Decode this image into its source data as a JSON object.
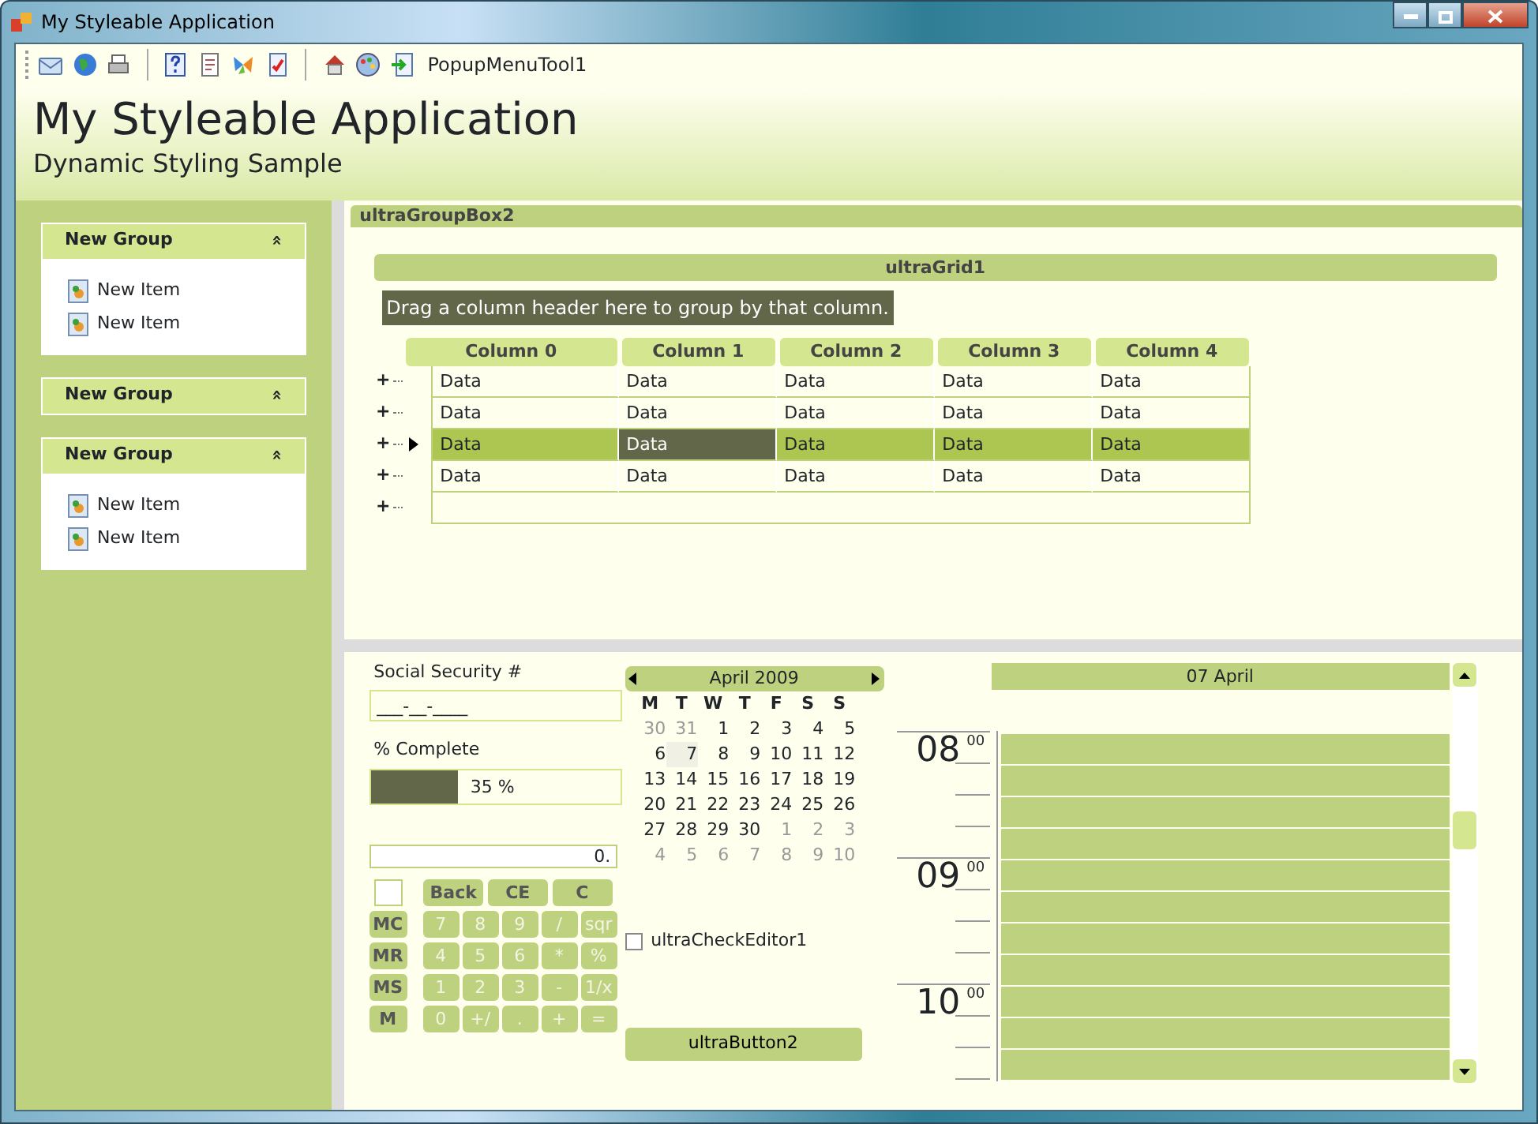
{
  "window": {
    "title": "My Styleable Application"
  },
  "toolbar": {
    "popup_label": "PopupMenuTool1"
  },
  "header": {
    "title": "My Styleable Application",
    "subtitle": "Dynamic Styling Sample"
  },
  "sidebar": {
    "groups": [
      {
        "title": "New Group",
        "chevron": "»",
        "items": [
          {
            "label": "New Item"
          },
          {
            "label": "New Item"
          }
        ]
      },
      {
        "title": "New Group",
        "chevron": "»"
      },
      {
        "title": "New Group",
        "chevron": "»",
        "items": [
          {
            "label": "New Item"
          },
          {
            "label": "New Item"
          }
        ]
      }
    ]
  },
  "group_box": {
    "title": "ultraGroupBox2"
  },
  "grid": {
    "caption": "ultraGrid1",
    "group_by_hint": "Drag a column header here to group by that column.",
    "columns": [
      "Column 0",
      "Column 1",
      "Column 2",
      "Column 3",
      "Column 4"
    ],
    "rows": [
      {
        "expander": "+",
        "selected": false,
        "cells": [
          {
            "text": "Data",
            "active": false
          },
          {
            "text": "Data",
            "active": false
          },
          {
            "text": "Data",
            "active": false
          },
          {
            "text": "Data",
            "active": false
          },
          {
            "text": "Data",
            "active": false
          }
        ]
      },
      {
        "expander": "+",
        "selected": false,
        "cells": [
          {
            "text": "Data",
            "active": false
          },
          {
            "text": "Data",
            "active": false
          },
          {
            "text": "Data",
            "active": false
          },
          {
            "text": "Data",
            "active": false
          },
          {
            "text": "Data",
            "active": false
          }
        ]
      },
      {
        "expander": "+",
        "selected": true,
        "cells": [
          {
            "text": "Data",
            "active": false
          },
          {
            "text": "Data",
            "active": true
          },
          {
            "text": "Data",
            "active": false
          },
          {
            "text": "Data",
            "active": false
          },
          {
            "text": "Data",
            "active": false
          }
        ]
      },
      {
        "expander": "+",
        "selected": false,
        "cells": [
          {
            "text": "Data",
            "active": false
          },
          {
            "text": "Data",
            "active": false
          },
          {
            "text": "Data",
            "active": false
          },
          {
            "text": "Data",
            "active": false
          },
          {
            "text": "Data",
            "active": false
          }
        ]
      }
    ],
    "add_row": {
      "expander": "+"
    }
  },
  "masked_editor": {
    "label": "Social Security #",
    "value": "___-__-____"
  },
  "progress": {
    "label": "% Complete",
    "level": 0.35,
    "reading": "35 %"
  },
  "calculator": {
    "display": "0.",
    "top_keys": [
      "Back",
      "CE",
      "C"
    ],
    "key_rows": [
      [
        {
          "label": "MC",
          "kind": "memory"
        },
        {
          "label": "7",
          "kind": "digit"
        },
        {
          "label": "8",
          "kind": "digit"
        },
        {
          "label": "9",
          "kind": "digit"
        },
        {
          "label": "/",
          "kind": "digit"
        },
        {
          "label": "sqr",
          "kind": "digit"
        }
      ],
      [
        {
          "label": "MR",
          "kind": "memory"
        },
        {
          "label": "4",
          "kind": "digit"
        },
        {
          "label": "5",
          "kind": "digit"
        },
        {
          "label": "6",
          "kind": "digit"
        },
        {
          "label": "*",
          "kind": "digit"
        },
        {
          "label": "%",
          "kind": "digit"
        }
      ],
      [
        {
          "label": "MS",
          "kind": "memory"
        },
        {
          "label": "1",
          "kind": "digit"
        },
        {
          "label": "2",
          "kind": "digit"
        },
        {
          "label": "3",
          "kind": "digit"
        },
        {
          "label": "-",
          "kind": "digit"
        },
        {
          "label": "1/x",
          "kind": "digit"
        }
      ],
      [
        {
          "label": "M",
          "kind": "memory"
        },
        {
          "label": "0",
          "kind": "digit"
        },
        {
          "label": "+/",
          "kind": "digit"
        },
        {
          "label": ".",
          "kind": "digit"
        },
        {
          "label": "+",
          "kind": "digit"
        },
        {
          "label": "=",
          "kind": "digit"
        }
      ]
    ]
  },
  "calendar": {
    "title": "April 2009",
    "weekdays": [
      "M",
      "T",
      "W",
      "T",
      "F",
      "S",
      "S"
    ],
    "weeks": [
      [
        {
          "d": "30",
          "other": true,
          "selected": false
        },
        {
          "d": "31",
          "other": true,
          "selected": false
        },
        {
          "d": "1",
          "other": false,
          "selected": false
        },
        {
          "d": "2",
          "other": false,
          "selected": false
        },
        {
          "d": "3",
          "other": false,
          "selected": false
        },
        {
          "d": "4",
          "other": false,
          "selected": false
        },
        {
          "d": "5",
          "other": false,
          "selected": false
        }
      ],
      [
        {
          "d": "6",
          "other": false,
          "selected": false
        },
        {
          "d": "7",
          "other": false,
          "selected": true
        },
        {
          "d": "8",
          "other": false,
          "selected": false
        },
        {
          "d": "9",
          "other": false,
          "selected": false
        },
        {
          "d": "10",
          "other": false,
          "selected": false
        },
        {
          "d": "11",
          "other": false,
          "selected": false
        },
        {
          "d": "12",
          "other": false,
          "selected": false
        }
      ],
      [
        {
          "d": "13",
          "other": false,
          "selected": false
        },
        {
          "d": "14",
          "other": false,
          "selected": false
        },
        {
          "d": "15",
          "other": false,
          "selected": false
        },
        {
          "d": "16",
          "other": false,
          "selected": false
        },
        {
          "d": "17",
          "other": false,
          "selected": false
        },
        {
          "d": "18",
          "other": false,
          "selected": false
        },
        {
          "d": "19",
          "other": false,
          "selected": false
        }
      ],
      [
        {
          "d": "20",
          "other": false,
          "selected": false
        },
        {
          "d": "21",
          "other": false,
          "selected": false
        },
        {
          "d": "22",
          "other": false,
          "selected": false
        },
        {
          "d": "23",
          "other": false,
          "selected": false
        },
        {
          "d": "24",
          "other": false,
          "selected": false
        },
        {
          "d": "25",
          "other": false,
          "selected": false
        },
        {
          "d": "26",
          "other": false,
          "selected": false
        }
      ],
      [
        {
          "d": "27",
          "other": false,
          "selected": false
        },
        {
          "d": "28",
          "other": false,
          "selected": false
        },
        {
          "d": "29",
          "other": false,
          "selected": false
        },
        {
          "d": "30",
          "other": false,
          "selected": false
        },
        {
          "d": "1",
          "other": true,
          "selected": false
        },
        {
          "d": "2",
          "other": true,
          "selected": false
        },
        {
          "d": "3",
          "other": true,
          "selected": false
        }
      ],
      [
        {
          "d": "4",
          "other": true,
          "selected": false
        },
        {
          "d": "5",
          "other": true,
          "selected": false
        },
        {
          "d": "6",
          "other": true,
          "selected": false
        },
        {
          "d": "7",
          "other": true,
          "selected": false
        },
        {
          "d": "8",
          "other": true,
          "selected": false
        },
        {
          "d": "9",
          "other": true,
          "selected": false
        },
        {
          "d": "10",
          "other": true,
          "selected": false
        }
      ]
    ]
  },
  "checkbox": {
    "label": "ultraCheckEditor1",
    "checked": false
  },
  "button": {
    "label": "ultraButton2"
  },
  "day_view": {
    "header": "07 April",
    "hours": [
      {
        "hour": "08",
        "minutes": "00"
      },
      {
        "hour": "09",
        "minutes": "00"
      },
      {
        "hour": "10",
        "minutes": "00"
      }
    ]
  }
}
